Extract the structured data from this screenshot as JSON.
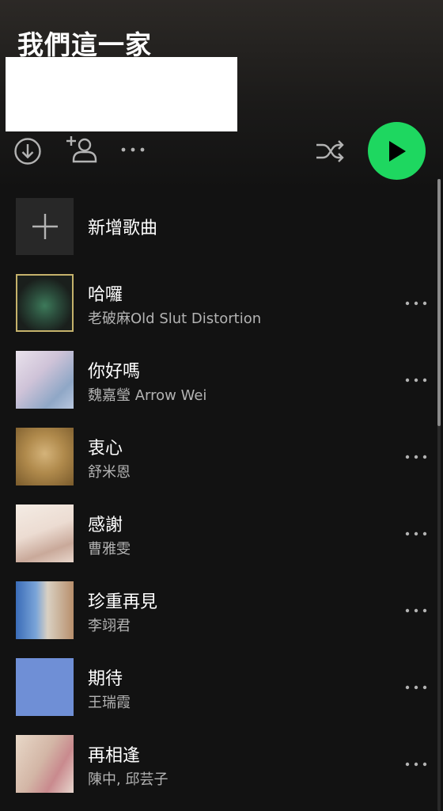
{
  "playlist": {
    "title": "我們這一家"
  },
  "controls": {
    "download_icon": "download-circle-icon",
    "add_user_icon": "add-user-icon",
    "more_icon": "more-dots-icon",
    "shuffle_icon": "shuffle-icon",
    "play_icon": "play-icon",
    "play_color": "#1ed760"
  },
  "add_song": {
    "label": "新增歌曲"
  },
  "tracks": [
    {
      "title": "哈囉",
      "artist": "老破麻Old Slut Distortion"
    },
    {
      "title": "你好嗎",
      "artist": "魏嘉瑩 Arrow Wei"
    },
    {
      "title": "衷心",
      "artist": "舒米恩"
    },
    {
      "title": "感謝",
      "artist": "曹雅雯"
    },
    {
      "title": "珍重再見",
      "artist": "李翊君"
    },
    {
      "title": "期待",
      "artist": "王瑞霞"
    },
    {
      "title": "再相逢",
      "artist": "陳中, 邱芸子"
    }
  ],
  "colors": {
    "background": "#121212",
    "secondary_text": "#b3b3b3",
    "accent": "#1ed760"
  }
}
